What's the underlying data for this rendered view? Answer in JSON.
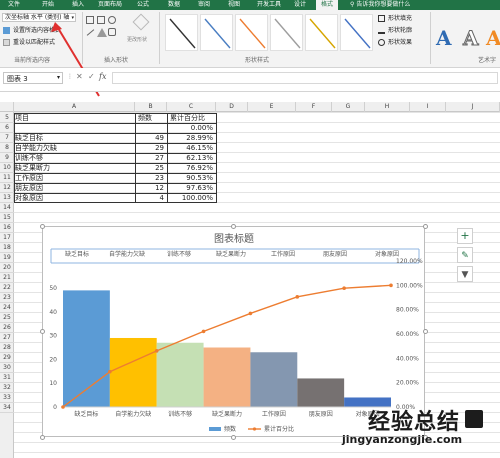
{
  "ribbon_tabs": [
    "文件",
    "开始",
    "插入",
    "页面布局",
    "公式",
    "数据",
    "审阅",
    "视图",
    "开发工具",
    "设计",
    "格式"
  ],
  "selected_tab": "格式",
  "tell_me": "告诉我你想要做什么",
  "selection": {
    "dropdown_value": "次坐标轴 水平 (类别) 轴",
    "format_selection": "设置所选内容格式",
    "reset_style": "重设以匹配样式",
    "group_label": "当前所选内容"
  },
  "insert_shapes": {
    "change_shape": "更改形状",
    "group_label": "插入形状"
  },
  "shape_styles": {
    "fill": "形状填充",
    "outline": "形状轮廓",
    "effects": "形状效果",
    "group_label": "形状样式"
  },
  "wordart": {
    "group_label": "艺术字"
  },
  "name_box": "图表 3",
  "columns": [
    "A",
    "B",
    "C",
    "D",
    "E",
    "F",
    "G",
    "H",
    "I",
    "J"
  ],
  "rows": [
    "5",
    "6",
    "7",
    "8",
    "9",
    "10",
    "11",
    "12",
    "13",
    "14",
    "15",
    "16",
    "17",
    "18",
    "19",
    "20",
    "21",
    "22",
    "23",
    "24",
    "25",
    "26",
    "27",
    "28",
    "29",
    "30",
    "31",
    "32",
    "33",
    "34"
  ],
  "table": {
    "headers": [
      "项目",
      "频数",
      "累计百分比"
    ],
    "rows": [
      [
        "",
        "",
        "0.00%"
      ],
      [
        "缺乏目标",
        "49",
        "28.99%"
      ],
      [
        "自学能力欠缺",
        "29",
        "46.15%"
      ],
      [
        "训练不够",
        "27",
        "62.13%"
      ],
      [
        "缺乏果断力",
        "25",
        "76.92%"
      ],
      [
        "工作原因",
        "23",
        "90.53%"
      ],
      [
        "朋友原因",
        "12",
        "97.63%"
      ],
      [
        "对象原因",
        "4",
        "100.00%"
      ]
    ]
  },
  "chart_data": {
    "type": "bar",
    "title": "图表标题",
    "categories": [
      "缺乏目标",
      "自学能力欠缺",
      "训练不够",
      "缺乏果断力",
      "工作原因",
      "朋友原因",
      "对象原因"
    ],
    "secondary_x_labels": [
      "缺乏目标",
      "自学能力欠缺",
      "训练不够",
      "缺乏果断力",
      "工作原因",
      "朋友原因",
      "对象原因"
    ],
    "series": [
      {
        "name": "频数",
        "type": "bar",
        "axis": "primary",
        "values": [
          49,
          29,
          27,
          25,
          23,
          12,
          4
        ],
        "colors": [
          "#5b9bd5",
          "#ffc000",
          "#c5e0b4",
          "#f4b183",
          "#8497b0",
          "#767171",
          "#4472c4"
        ]
      },
      {
        "name": "累计百分比",
        "type": "line",
        "axis": "secondary",
        "color": "#ed7d31",
        "x": [
          0,
          1,
          2,
          3,
          4,
          5,
          6,
          7
        ],
        "values": [
          0.0,
          28.99,
          46.15,
          62.13,
          76.92,
          90.53,
          97.63,
          100.0
        ]
      }
    ],
    "primary_y": {
      "range": [
        0,
        50
      ],
      "ticks": [
        "0",
        "10",
        "20",
        "30",
        "40",
        "50"
      ]
    },
    "secondary_y": {
      "range": [
        0,
        120
      ],
      "ticks": [
        "0.00%",
        "20.00%",
        "40.00%",
        "60.00%",
        "80.00%",
        "100.00%",
        "120.00%"
      ]
    },
    "legend": [
      "频数",
      "累计百分比"
    ],
    "legend_position": "bottom",
    "grid": false
  },
  "colors": {
    "ribbon_green": "#217346",
    "arrow_red": "#e0302f"
  },
  "icons": [
    "search-icon",
    "plus-icon",
    "brush-icon",
    "filter-icon",
    "dropdown-arrow-icon"
  ],
  "watermark": {
    "chinese": "经验总结",
    "url": "jingyanzongjie.com"
  }
}
